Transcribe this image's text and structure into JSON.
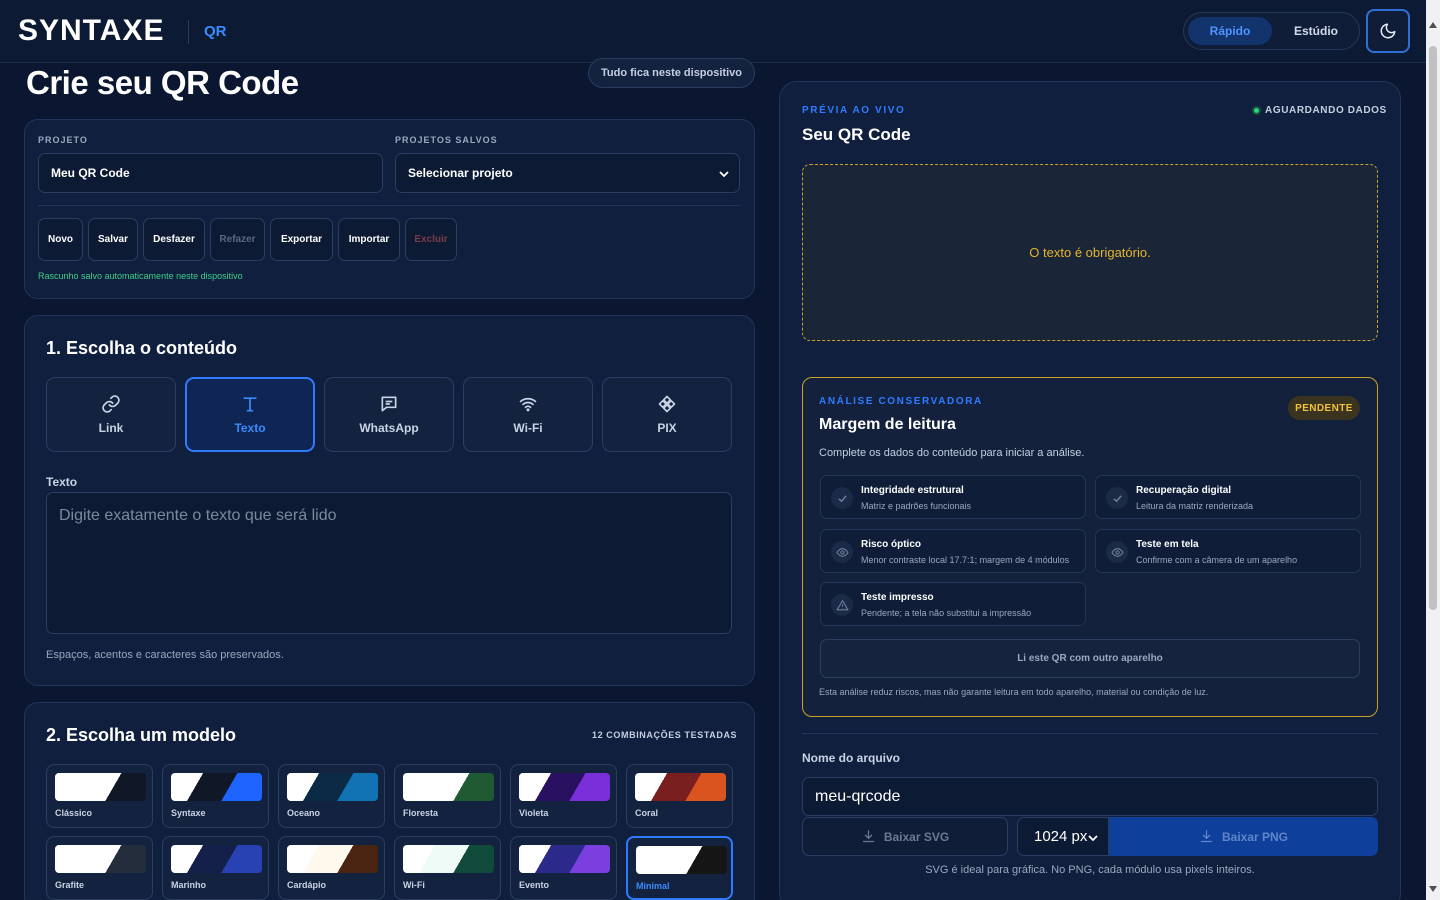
{
  "header": {
    "brand": "SYNTAXE",
    "brand_suffix": "QR",
    "modes": [
      "Rápido",
      "Estúdio"
    ],
    "active_mode": "Rápido"
  },
  "page": {
    "title": "Crie seu QR Code",
    "local_pill": "Tudo fica neste dispositivo"
  },
  "project": {
    "project_label": "PROJETO",
    "project_value": "Meu QR Code",
    "saved_label": "PROJETOS SALVOS",
    "saved_value": "Selecionar projeto",
    "buttons": [
      "Novo",
      "Salvar",
      "Desfazer",
      "Refazer",
      "Exportar",
      "Importar",
      "Excluir"
    ],
    "autosave": "Rascunho salvo automaticamente neste dispositivo"
  },
  "content": {
    "title": "1. Escolha o conteúdo",
    "types": [
      "Link",
      "Texto",
      "WhatsApp",
      "Wi-Fi",
      "PIX"
    ],
    "active_type": "Texto",
    "field_label": "Texto",
    "placeholder": "Digite exatamente o texto que será lido",
    "hint": "Espaços, acentos e caracteres são preservados."
  },
  "models": {
    "title": "2. Escolha um modelo",
    "count": "12 COMBINAÇÕES TESTADAS",
    "items": [
      {
        "name": "Clássico",
        "c1": "#ffffff",
        "c2": "#101828"
      },
      {
        "name": "Syntaxe",
        "c1": "#101828",
        "c2": "#1e64ff"
      },
      {
        "name": "Oceano",
        "c1": "#0b2a45",
        "c2": "#1173b3"
      },
      {
        "name": "Floresta",
        "c1": "#ffffff",
        "c2": "#1f5a33"
      },
      {
        "name": "Violeta",
        "c1": "#2a1060",
        "c2": "#7a2fd8"
      },
      {
        "name": "Coral",
        "c1": "#7a1f20",
        "c2": "#d9541f"
      },
      {
        "name": "Grafite",
        "c1": "#ffffff",
        "c2": "#232d3c"
      },
      {
        "name": "Marinho",
        "c1": "#14204a",
        "c2": "#2842b3"
      },
      {
        "name": "Cardápio",
        "c1": "#fff8ec",
        "c2": "#4a2410"
      },
      {
        "name": "Wi-Fi",
        "c1": "#effbf6",
        "c2": "#0f4a3a"
      },
      {
        "name": "Evento",
        "c1": "#2b2a8a",
        "c2": "#7b3fe0"
      },
      {
        "name": "Minimal",
        "c1": "#ffffff",
        "c2": "#151515"
      }
    ],
    "active": "Minimal"
  },
  "preview": {
    "eyebrow": "PRÉVIA AO VIVO",
    "title": "Seu QR Code",
    "status": "AGUARDANDO DADOS",
    "message": "O texto é obrigatório."
  },
  "analysis": {
    "eyebrow": "ANÁLISE CONSERVADORA",
    "title": "Margem de leitura",
    "badge": "PENDENTE",
    "description": "Complete os dados do conteúdo para iniciar a análise.",
    "checks": [
      {
        "title": "Integridade estrutural",
        "sub": "Matriz e padrões funcionais",
        "icon": "check-icon"
      },
      {
        "title": "Recuperação digital",
        "sub": "Leitura da matriz renderizada",
        "icon": "check-icon"
      },
      {
        "title": "Risco óptico",
        "sub": "Menor contraste local 17.7:1; margem de 4 módulos",
        "icon": "eye-icon"
      },
      {
        "title": "Teste em tela",
        "sub": "Confirme com a câmera de um aparelho",
        "icon": "eye-icon"
      },
      {
        "title": "Teste impresso",
        "sub": "Pendente; a tela não substitui a impressão",
        "icon": "warning-icon"
      }
    ],
    "read_button": "Li este QR com outro aparelho",
    "disclaimer": "Esta análise reduz riscos, mas não garante leitura em todo aparelho, material ou condição de luz."
  },
  "export": {
    "file_label": "Nome do arquivo",
    "file_value": "meu-qrcode",
    "svg_button": "Baixar SVG",
    "size": "1024 px",
    "png_button": "Baixar PNG",
    "note": "SVG é ideal para gráfica. No PNG, cada módulo usa pixels inteiros."
  }
}
